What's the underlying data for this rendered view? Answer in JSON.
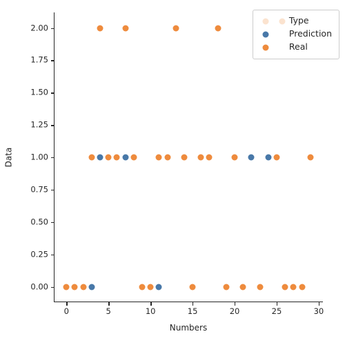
{
  "chart_data": {
    "type": "scatter",
    "title": "",
    "xlabel": "Numbers",
    "ylabel": "Data",
    "xlim": [
      -1.5,
      30.5
    ],
    "ylim": [
      -0.12,
      2.12
    ],
    "xticks": [
      0,
      5,
      10,
      15,
      20,
      25,
      30
    ],
    "xticklabels": [
      "0",
      "5",
      "10",
      "15",
      "20",
      "25",
      "30"
    ],
    "yticks": [
      0.0,
      0.25,
      0.5,
      0.75,
      1.0,
      1.25,
      1.5,
      1.75,
      2.0
    ],
    "yticklabels": [
      "0.00",
      "0.25",
      "0.50",
      "0.75",
      "1.00",
      "1.25",
      "1.50",
      "1.75",
      "2.00"
    ],
    "grid": false,
    "legend_position": "upper right",
    "series": [
      {
        "name": "Prediction",
        "color": "#4878a8",
        "x": [
          3,
          11,
          4,
          7,
          22,
          24
        ],
        "y": [
          0,
          0,
          1,
          1,
          1,
          1
        ]
      },
      {
        "name": "Real",
        "color": "#ee8b3d",
        "x": [
          0,
          1,
          2,
          9,
          10,
          15,
          19,
          21,
          23,
          26,
          27,
          28,
          3,
          5,
          6,
          8,
          11,
          12,
          14,
          16,
          17,
          20,
          25,
          29,
          4,
          7,
          13,
          18
        ],
        "y": [
          0,
          0,
          0,
          0,
          0,
          0,
          0,
          0,
          0,
          0,
          0,
          0,
          1,
          1,
          1,
          1,
          1,
          1,
          1,
          1,
          1,
          1,
          1,
          1,
          2,
          2,
          2,
          2
        ]
      }
    ]
  },
  "legend": {
    "title": "Type",
    "title_swatch_color": "#fbe3cf",
    "entries": [
      {
        "label": "Prediction",
        "color": "#4878a8"
      },
      {
        "label": "Real",
        "color": "#ee8b3d"
      }
    ]
  }
}
